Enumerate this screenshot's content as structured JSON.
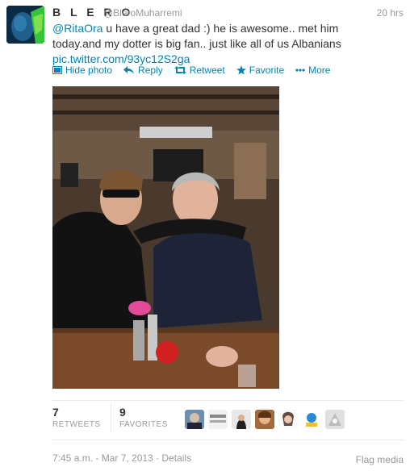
{
  "tweet": {
    "display_name": "B L E R O",
    "handle": "@BleroMuharremi",
    "time_ago": "20 hrs",
    "mention": "@RitaOra",
    "text_line1": " u have a great dad :) he is awesome.. met him",
    "text_line2": "today.and my dotter is big fan.. just like all of us Albanians",
    "link": "pic.twitter.com/93yc12S2ga"
  },
  "actions": {
    "hide_photo": "Hide photo",
    "reply": "Reply",
    "retweet": "Retweet",
    "favorite": "Favorite",
    "more": "More"
  },
  "stats": {
    "retweets_count": "7",
    "retweets_label": "RETWEETS",
    "favorites_count": "9",
    "favorites_label": "FAVORITES"
  },
  "footer": {
    "date": "7:45 a.m. - Mar 7, 2013 · Details",
    "flag": "Flag media"
  },
  "colors": {
    "link": "#0084b4",
    "muted": "#999999",
    "text": "#333333"
  }
}
